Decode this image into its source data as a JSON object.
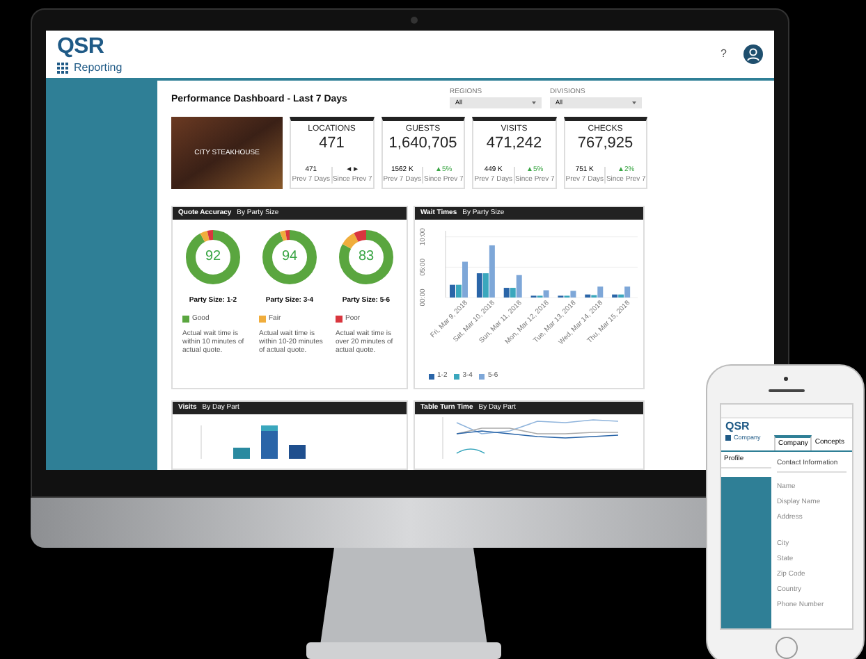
{
  "header": {
    "logo": "QSR",
    "app_name": "Reporting",
    "help": "?"
  },
  "dashboard": {
    "title": "Performance Dashboard - Last 7 Days",
    "filters": [
      {
        "label": "REGIONS",
        "value": "All"
      },
      {
        "label": "DIVISIONS",
        "value": "All"
      }
    ],
    "hero": {
      "caption": "CITY STEAKHOUSE"
    },
    "kpis": [
      {
        "title": "LOCATIONS",
        "value": "471",
        "prev": "471",
        "prev_label": "Prev 7 Days",
        "change": "◄►",
        "color": "#222222",
        "change_label": "Since Prev 7"
      },
      {
        "title": "GUESTS",
        "value": "1,640,705",
        "prev": "1562 K",
        "prev_label": "Prev 7 Days",
        "change": "▲5%",
        "color": "#3aa544",
        "change_label": "Since Prev 7"
      },
      {
        "title": "VISITS",
        "value": "471,242",
        "prev": "449 K",
        "prev_label": "Prev 7 Days",
        "change": "▲5%",
        "color": "#3aa544",
        "change_label": "Since Prev 7"
      },
      {
        "title": "CHECKS",
        "value": "767,925",
        "prev": "751 K",
        "prev_label": "Prev 7 Days",
        "change": "▲2%",
        "color": "#3aa544",
        "change_label": "Since Prev 7"
      }
    ],
    "quote_accuracy": {
      "title": "Quote Accuracy",
      "subtitle": "By Party Size",
      "donuts": [
        {
          "score": "92",
          "label": "Party Size: 1-2"
        },
        {
          "score": "94",
          "label": "Party Size: 3-4"
        },
        {
          "score": "83",
          "label": "Party Size: 5-6"
        }
      ],
      "legend": [
        {
          "label": "Good",
          "color": "#5aa63f",
          "note": "Actual wait time is within 10 minutes of actual quote."
        },
        {
          "label": "Fair",
          "color": "#f0ad3c",
          "note": "Actual wait time is within 10-20 minutes of actual quote."
        },
        {
          "label": "Poor",
          "color": "#d9363e",
          "note": "Actual wait time is over 20 minutes of actual quote."
        }
      ]
    },
    "wait_times": {
      "title": "Wait Times",
      "subtitle": "By Party Size",
      "chart_data": {
        "type": "bar",
        "categories": [
          "Fri, Mar 9, 2018",
          "Sat, Mar 10, 2018",
          "Sun, Mar 11, 2018",
          "Mon, Mar 12, 2018",
          "Tue, Mar 13, 2018",
          "Wed, Mar 14, 2018",
          "Thu, Mar 15, 2018"
        ],
        "ylim": [
          0,
          11
        ],
        "yticks": [
          {
            "value": 0,
            "label": "00:00"
          },
          {
            "value": 5,
            "label": "05:00"
          },
          {
            "value": 10,
            "label": "10:00"
          }
        ],
        "series": [
          {
            "name": "1-2",
            "color": "#2a65a8",
            "values": [
              2.1,
              4.0,
              1.6,
              0.3,
              0.3,
              0.5,
              0.5
            ]
          },
          {
            "name": "3-4",
            "color": "#3aa7bd",
            "values": [
              2.1,
              4.0,
              1.6,
              0.3,
              0.3,
              0.4,
              0.5
            ]
          },
          {
            "name": "5-6",
            "color": "#7ea7d8",
            "values": [
              5.9,
              8.6,
              3.7,
              1.2,
              1.1,
              1.8,
              1.8
            ]
          }
        ]
      }
    },
    "visits": {
      "title": "Visits",
      "subtitle": "By Day Part"
    },
    "table_turn": {
      "title": "Table Turn Time",
      "subtitle": "By Day Part"
    }
  },
  "phone": {
    "logo": "QSR",
    "section": "Company",
    "tabs": [
      {
        "label": "Company",
        "selected": true
      },
      {
        "label": "Concepts",
        "selected": false
      }
    ],
    "menu_title": "Profile",
    "heading": "Contact Information",
    "fields": [
      "Name",
      "Display Name",
      "Address",
      "City",
      "State",
      "Zip Code",
      "Country",
      "Phone Number"
    ]
  }
}
